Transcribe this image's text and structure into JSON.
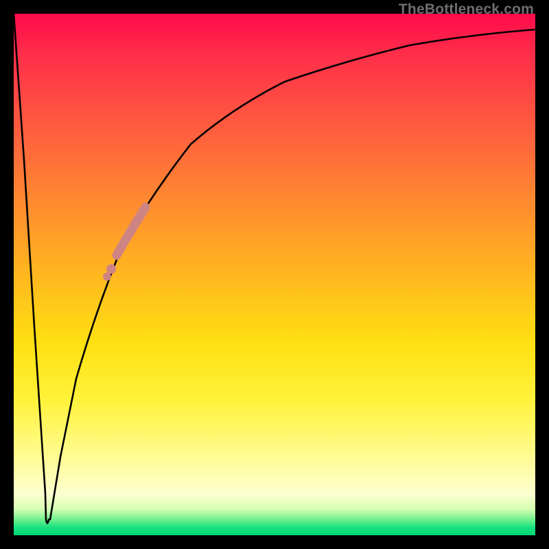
{
  "watermark": "TheBottleneck.com",
  "colors": {
    "background": "#000000",
    "curve": "#000000",
    "highlight": "#cf8484",
    "watermark_text": "#6e6e6e",
    "gradient_top": "#ff0a4b",
    "gradient_bottom": "#00d877"
  },
  "chart_data": {
    "type": "line",
    "title": "",
    "xlabel": "",
    "ylabel": "",
    "xlim": [
      0,
      100
    ],
    "ylim": [
      0,
      100
    ],
    "grid": false,
    "legend": false,
    "series": [
      {
        "name": "bottleneck-curve",
        "x": [
          0,
          2,
          4,
          6,
          6.2,
          6.5,
          7,
          9,
          12,
          16,
          21,
          27,
          34,
          42,
          52,
          64,
          78,
          92,
          100
        ],
        "y": [
          100,
          72,
          40,
          8,
          3,
          2,
          3,
          15,
          30,
          44,
          56,
          66,
          75,
          82,
          87,
          91,
          94,
          96,
          97
        ]
      }
    ],
    "annotations": [
      {
        "name": "highlight-segment",
        "x_range": [
          19,
          25
        ],
        "y_range": [
          53,
          63
        ],
        "color": "#cf8484"
      },
      {
        "name": "highlight-dot",
        "x": 18,
        "y": 50,
        "color": "#cf8484"
      }
    ]
  }
}
